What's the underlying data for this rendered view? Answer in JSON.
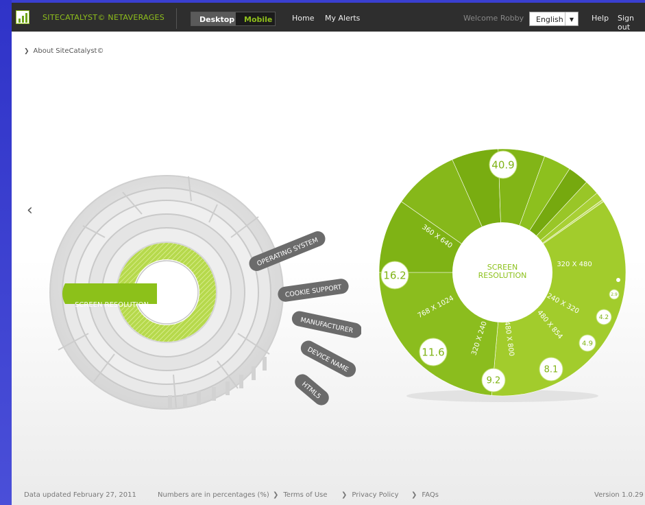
{
  "app": {
    "brand": "SITECATALYST© NETAVERAGES",
    "logo_icon": "bar-chart-logo-icon"
  },
  "topbar": {
    "segment_desktop": "Desktop",
    "segment_mobile": "Mobile",
    "nav_home": "Home",
    "nav_alerts": "My Alerts",
    "welcome": "Welcome Robby",
    "language": "English",
    "help": "Help",
    "sign_out": "Sign out"
  },
  "breadcrumb": {
    "label": "About SiteCatalyst©",
    "icon": "chevron-right-icon"
  },
  "left_wheel": {
    "selected": "SCREEN RESOLUTION",
    "tabs": [
      "OPERATING SYSTEM",
      "COOKIE SUPPORT",
      "MANUFACTURER",
      "DEVICE NAME",
      "HTML5"
    ]
  },
  "pie": {
    "center_line1": "SCREEN",
    "center_line2": "RESOLUTION",
    "slice_labels": [
      "360 X 640",
      "320 X 480",
      "240 X 320",
      "480 X 854",
      "480 X 800",
      "320 X 240",
      "768 X 1024"
    ],
    "value_bubbles": [
      "40.9",
      "16.2",
      "11.6",
      "9.2",
      "8.1",
      "4.9",
      "4.2",
      "2.9"
    ],
    "color": "#8cc11a"
  },
  "footer": {
    "updated": "Data updated February 27, 2011",
    "units": "Numbers are in percentages (%)",
    "terms": "Terms of Use",
    "privacy": "Privacy Policy",
    "faqs": "FAQs",
    "version": "Version 1.0.29"
  },
  "colors": {
    "accent": "#8cc11a",
    "bar": "#2e2e2e",
    "side": "#3d3fc4"
  }
}
